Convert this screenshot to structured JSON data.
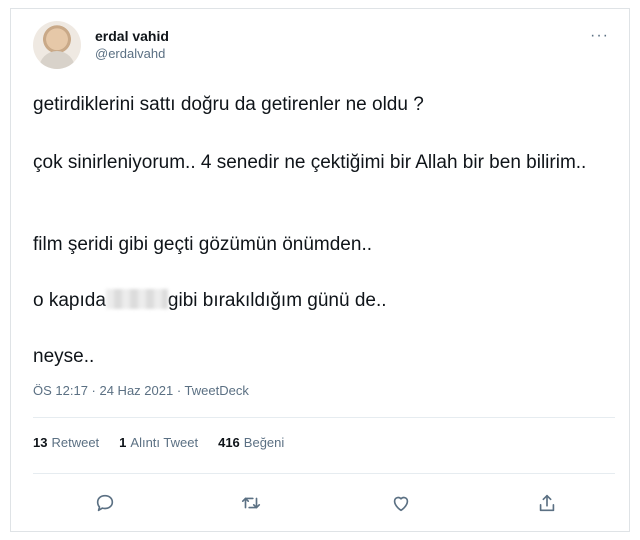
{
  "user": {
    "display_name": "erdal vahid",
    "handle": "@erdalvahd"
  },
  "tweet": {
    "line1": "getirdiklerini sattı doğru da getirenler ne oldu ?",
    "line2": "çok sinirleniyorum.. 4 senedir ne çektiğimi bir Allah bir ben bilirim..",
    "line3": "film şeridi gibi geçti gözümün önümden..",
    "line4_before": "o kapıda",
    "line4_after": "gibi bırakıldığım günü de..",
    "line5": "neyse.."
  },
  "meta": {
    "timestamp": "ÖS 12:17 · 24 Haz 2021 · TweetDeck"
  },
  "stats": {
    "retweets_count": "13",
    "retweets_label": "Retweet",
    "quotes_count": "1",
    "quotes_label": "Alıntı Tweet",
    "likes_count": "416",
    "likes_label": "Beğeni"
  },
  "icons": {
    "more": "more-horizontal-icon",
    "reply": "reply-icon",
    "retweet": "retweet-icon",
    "like": "heart-icon",
    "share": "share-icon"
  },
  "colors": {
    "text": "#0f1419",
    "muted": "#5b7083",
    "border": "#dfe3e6"
  }
}
